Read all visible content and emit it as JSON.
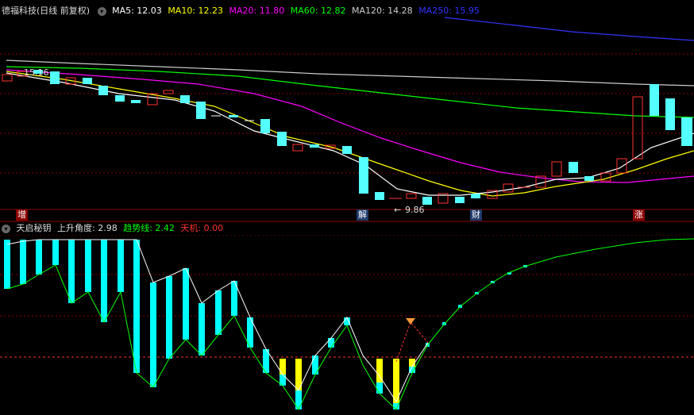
{
  "main_legend": {
    "stock": "德福科技(日线 前复权)",
    "ma5": "MA5: 12.03",
    "ma10": "MA10: 12.23",
    "ma20": "MA20: 11.80",
    "ma60": "MA60: 12.82",
    "ma120": "MA120: 14.28",
    "ma250": "MA250: 15.95"
  },
  "main_annotations": {
    "high_label": "15.16",
    "low_label": "9.86",
    "events": [
      "增",
      "解",
      "财",
      "涨"
    ]
  },
  "sub_legend": {
    "name": "天启秘钥",
    "angle": "上升角度: 2.98",
    "trend": "趋势线: 2.42",
    "tianji": "天机: 0.00"
  },
  "colors": {
    "ma5": "#ffffff",
    "ma10": "#ffff00",
    "ma20": "#ff00ff",
    "ma60": "#00ff00",
    "ma120": "#cccccc",
    "ma250": "#3333ff",
    "up": "#ff3232",
    "down": "#54ffff",
    "bar_cyan": "#00ffff",
    "bar_yellow": "#ffff00"
  }
}
